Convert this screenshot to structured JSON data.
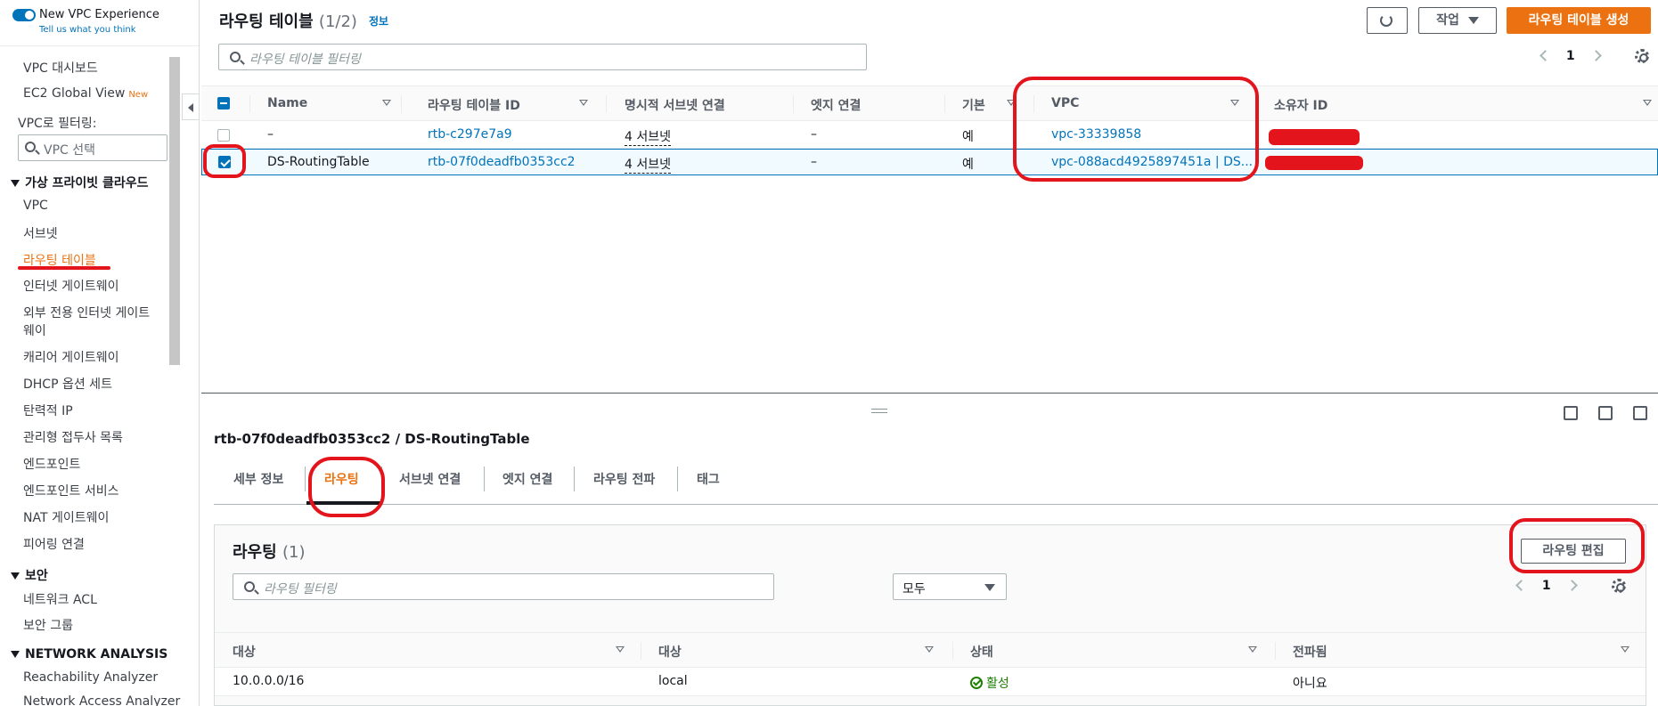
{
  "sidebar": {
    "experience_title": "New VPC Experience",
    "experience_sub": "Tell us what you think",
    "items_top": [
      "VPC 대시보드",
      "EC2 Global View"
    ],
    "new_badge": "New",
    "filter_label": "VPC로 필터링:",
    "filter_placeholder": "VPC 선택",
    "section_vpc": "가상 프라이빗 클라우드",
    "vpc_items": [
      "VPC",
      "서브넷",
      "라우팅 테이블",
      "인터넷 게이트웨이",
      "외부 전용 인터넷 게이트",
      "웨이",
      "캐리어 게이트웨이",
      "DHCP 옵션 세트",
      "탄력적 IP",
      "관리형 접두사 목록",
      "엔드포인트",
      "엔드포인트 서비스",
      "NAT 게이트웨이",
      "피어링 연결"
    ],
    "section_security": "보안",
    "security_items": [
      "네트워크 ACL",
      "보안 그룹"
    ],
    "section_network": "NETWORK ANALYSIS",
    "network_items": [
      "Reachability Analyzer",
      "Network Access Analyzer"
    ]
  },
  "header": {
    "title": "라우팅 테이블",
    "count": "(1/2)",
    "info": "정보",
    "actions_label": "작업",
    "create_label": "라우팅 테이블 생성",
    "filter_placeholder": "라우팅 테이블 필터링",
    "page": "1"
  },
  "table": {
    "columns": [
      "Name",
      "라우팅 테이블 ID",
      "명시적 서브넷 연결",
      "엣지 연결",
      "기본",
      "VPC",
      "소유자 ID"
    ],
    "rows": [
      {
        "name": "–",
        "id": "rtb-c297e7a9",
        "subnets": "4 서브넷",
        "edge": "–",
        "main": "예",
        "vpc": "vpc-33339858",
        "selected": false
      },
      {
        "name": "DS-RoutingTable",
        "id": "rtb-07f0deadfb0353cc2",
        "subnets": "4 서브넷",
        "edge": "–",
        "main": "예",
        "vpc": "vpc-088acd4925897451a | DS...",
        "selected": true
      }
    ]
  },
  "detail": {
    "title": "rtb-07f0deadfb0353cc2 / DS-RoutingTable",
    "tabs": [
      "세부 정보",
      "라우팅",
      "서브넷 연결",
      "엣지 연결",
      "라우팅 전파",
      "태그"
    ],
    "active_tab": "라우팅"
  },
  "routes": {
    "title": "라우팅",
    "count": "(1)",
    "edit_label": "라우팅 편집",
    "filter_placeholder": "라우팅 필터링",
    "select_value": "모두",
    "page": "1",
    "columns": [
      "대상",
      "대상",
      "상태",
      "전파됨"
    ],
    "rows": [
      {
        "destination": "10.0.0.0/16",
        "target": "local",
        "status": "활성",
        "propagated": "아니요"
      }
    ]
  },
  "colors": {
    "accent": "#ec7211",
    "link": "#0073bb",
    "annotation": "#e3141b"
  }
}
